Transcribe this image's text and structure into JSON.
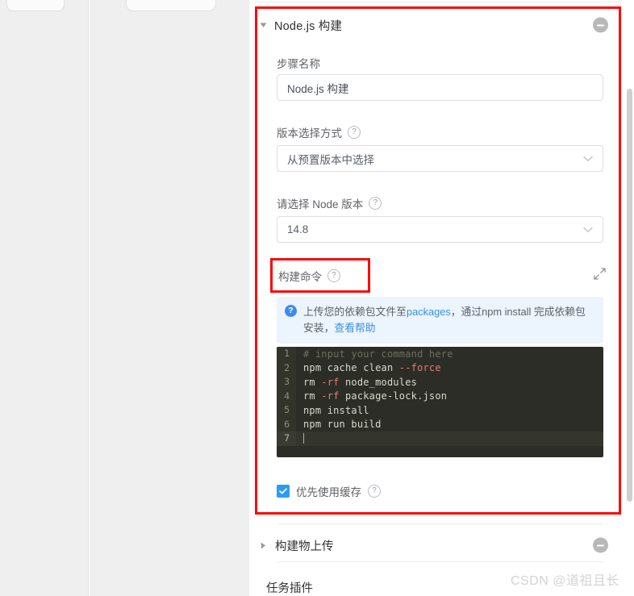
{
  "window": {
    "background_color": "#ffffff",
    "panel_background_color": "#efeff0"
  },
  "annotations": {
    "color": "#fb0a09",
    "outer_box_name": "node-build-step-highlight",
    "inner_box_name": "build-command-label-highlight"
  },
  "scrollbar": {
    "name": "vertical-scrollbar"
  },
  "node_build_section": {
    "title": "Node.js 构建",
    "expanded": true,
    "collapse_icon": "minus-circle-icon",
    "toggle_icon": "caret-down-icon",
    "fields": {
      "step_name": {
        "label": "步骤名称",
        "value": "Node.js 构建"
      },
      "version_mode": {
        "label": "版本选择方式",
        "help_icon": "question-mark-icon",
        "value": "从预置版本中选择",
        "chevron_icon": "chevron-down-icon"
      },
      "node_version": {
        "label": "请选择 Node 版本",
        "help_icon": "question-mark-icon",
        "value": "14.8",
        "chevron_icon": "chevron-down-icon"
      },
      "build_command": {
        "label": "构建命令",
        "help_icon": "question-mark-icon",
        "expand_icon": "expand-fullscreen-icon"
      }
    },
    "info_banner": {
      "icon": "question-circle-icon",
      "text_part_1": "上传您的依赖包文件至",
      "link_1": "packages",
      "text_part_2": "，通过npm install 完成依赖包安装，",
      "link_2": "查看帮助"
    },
    "code_editor": {
      "lines": [
        {
          "number": "1",
          "active": false,
          "tokens": [
            {
              "text": "# input your command here",
              "type": "comment"
            }
          ]
        },
        {
          "number": "2",
          "active": false,
          "tokens": [
            {
              "text": "npm cache clean ",
              "type": "plain"
            },
            {
              "text": "--force",
              "type": "flag"
            }
          ]
        },
        {
          "number": "3",
          "active": false,
          "tokens": [
            {
              "text": "rm ",
              "type": "plain"
            },
            {
              "text": "-rf",
              "type": "flag"
            },
            {
              "text": " node_modules",
              "type": "plain"
            }
          ]
        },
        {
          "number": "4",
          "active": false,
          "tokens": [
            {
              "text": "rm ",
              "type": "plain"
            },
            {
              "text": "-rf",
              "type": "flag"
            },
            {
              "text": " package-lock.json",
              "type": "plain"
            }
          ]
        },
        {
          "number": "5",
          "active": false,
          "tokens": [
            {
              "text": "npm install",
              "type": "plain"
            }
          ]
        },
        {
          "number": "6",
          "active": false,
          "tokens": [
            {
              "text": "npm run build",
              "type": "plain"
            }
          ]
        },
        {
          "number": "7",
          "active": true,
          "tokens": []
        }
      ]
    },
    "cache_option": {
      "checked": true,
      "label": "优先使用缓存",
      "help_icon": "question-mark-icon"
    }
  },
  "artifact_section": {
    "title": "构建物上传",
    "expanded": false,
    "toggle_icon": "caret-right-icon",
    "collapse_icon": "minus-circle-icon"
  },
  "plugin_section": {
    "title": "任务插件"
  },
  "watermark": {
    "text": "CSDN @道祖且长"
  }
}
